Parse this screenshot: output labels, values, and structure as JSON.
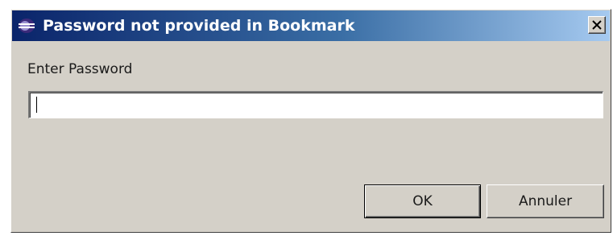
{
  "window": {
    "title": "Password not provided in Bookmark",
    "close_symbol": "×",
    "icon": "eclipse-app-icon"
  },
  "form": {
    "password_label": "Enter Password",
    "password_value": "",
    "password_placeholder": ""
  },
  "buttons": {
    "ok_label": "OK",
    "cancel_label": "Annuler"
  },
  "colors": {
    "titlebar_start": "#0a246a",
    "titlebar_end": "#a6caf0",
    "dialog_bg": "#d4d0c8"
  }
}
